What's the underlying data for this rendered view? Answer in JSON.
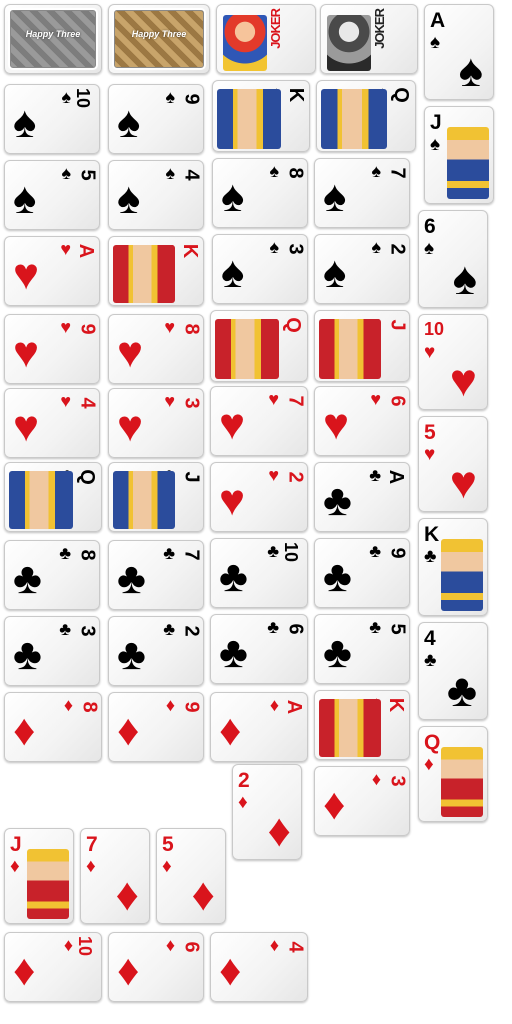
{
  "colors": {
    "red": "#d9141c",
    "black": "#000000",
    "silver_back": "#8f8f8f",
    "gold_back": "#b58f56"
  },
  "backs": [
    {
      "name": "silver",
      "text": "Happy Three"
    },
    {
      "name": "gold",
      "text": "Happy Three"
    }
  ],
  "jokers": [
    {
      "name": "color-joker",
      "word": "JOKER",
      "color": "red"
    },
    {
      "name": "mono-joker",
      "word": "JOKER",
      "color": "black"
    }
  ],
  "cards": [
    {
      "rank": "A",
      "suit": "spade",
      "upright": true
    },
    {
      "rank": "10",
      "suit": "spade",
      "upright": false
    },
    {
      "rank": "9",
      "suit": "spade",
      "upright": false
    },
    {
      "rank": "K",
      "suit": "spade",
      "upright": false,
      "face": true
    },
    {
      "rank": "Q",
      "suit": "spade",
      "upright": false,
      "face": true
    },
    {
      "rank": "J",
      "suit": "spade",
      "upright": true,
      "face": true
    },
    {
      "rank": "5",
      "suit": "spade",
      "upright": false
    },
    {
      "rank": "4",
      "suit": "spade",
      "upright": false
    },
    {
      "rank": "8",
      "suit": "spade",
      "upright": false
    },
    {
      "rank": "7",
      "suit": "spade",
      "upright": false
    },
    {
      "rank": "6",
      "suit": "spade",
      "upright": true
    },
    {
      "rank": "A",
      "suit": "heart",
      "upright": false
    },
    {
      "rank": "K",
      "suit": "heart",
      "upright": false,
      "face": true
    },
    {
      "rank": "3",
      "suit": "spade",
      "upright": false
    },
    {
      "rank": "2",
      "suit": "spade",
      "upright": false
    },
    {
      "rank": "9",
      "suit": "heart",
      "upright": false
    },
    {
      "rank": "8",
      "suit": "heart",
      "upright": false
    },
    {
      "rank": "Q",
      "suit": "heart",
      "upright": false,
      "face": true
    },
    {
      "rank": "J",
      "suit": "heart",
      "upright": false,
      "face": true
    },
    {
      "rank": "10",
      "suit": "heart",
      "upright": true
    },
    {
      "rank": "4",
      "suit": "heart",
      "upright": false
    },
    {
      "rank": "3",
      "suit": "heart",
      "upright": false
    },
    {
      "rank": "7",
      "suit": "heart",
      "upright": false
    },
    {
      "rank": "6",
      "suit": "heart",
      "upright": false
    },
    {
      "rank": "5",
      "suit": "heart",
      "upright": true
    },
    {
      "rank": "Q",
      "suit": "club",
      "upright": false,
      "face": true
    },
    {
      "rank": "J",
      "suit": "club",
      "upright": false,
      "face": true
    },
    {
      "rank": "2",
      "suit": "heart",
      "upright": false
    },
    {
      "rank": "A",
      "suit": "club",
      "upright": false
    },
    {
      "rank": "K",
      "suit": "club",
      "upright": true,
      "face": true
    },
    {
      "rank": "8",
      "suit": "club",
      "upright": false
    },
    {
      "rank": "7",
      "suit": "club",
      "upright": false
    },
    {
      "rank": "10",
      "suit": "club",
      "upright": false
    },
    {
      "rank": "9",
      "suit": "club",
      "upright": false
    },
    {
      "rank": "3",
      "suit": "club",
      "upright": false
    },
    {
      "rank": "2",
      "suit": "club",
      "upright": false
    },
    {
      "rank": "6",
      "suit": "club",
      "upright": false
    },
    {
      "rank": "5",
      "suit": "club",
      "upright": false
    },
    {
      "rank": "4",
      "suit": "club",
      "upright": true
    },
    {
      "rank": "8",
      "suit": "diamond",
      "upright": false
    },
    {
      "rank": "9",
      "suit": "diamond",
      "upright": false
    },
    {
      "rank": "A",
      "suit": "diamond",
      "upright": false
    },
    {
      "rank": "K",
      "suit": "diamond",
      "upright": false,
      "face": true
    },
    {
      "rank": "Q",
      "suit": "diamond",
      "upright": true,
      "face": true
    },
    {
      "rank": "2",
      "suit": "diamond",
      "upright": true
    },
    {
      "rank": "3",
      "suit": "diamond",
      "upright": false
    },
    {
      "rank": "J",
      "suit": "diamond",
      "upright": true,
      "face": true
    },
    {
      "rank": "7",
      "suit": "diamond",
      "upright": true
    },
    {
      "rank": "5",
      "suit": "diamond",
      "upright": true
    },
    {
      "rank": "10",
      "suit": "diamond",
      "upright": false
    },
    {
      "rank": "6",
      "suit": "diamond",
      "upright": false
    },
    {
      "rank": "4",
      "suit": "diamond",
      "upright": false
    }
  ]
}
